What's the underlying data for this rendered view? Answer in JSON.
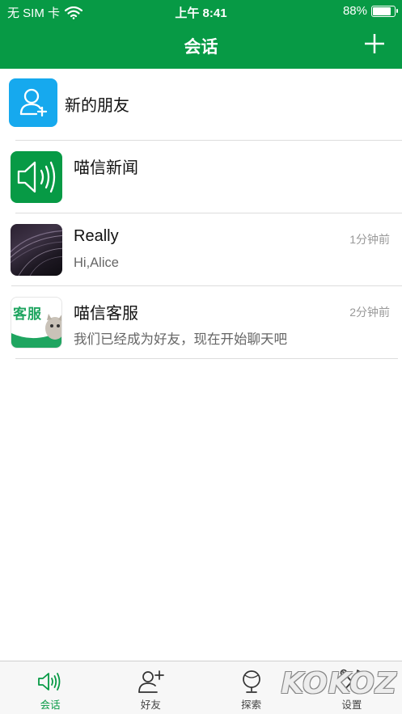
{
  "status_bar": {
    "carrier": "无 SIM 卡",
    "time": "上午 8:41",
    "battery": "88%"
  },
  "header": {
    "title": "会话",
    "add_icon": "plus-icon"
  },
  "conversations": [
    {
      "name": "新的朋友",
      "preview": "",
      "time": "",
      "avatar_icon": "add-friend-icon"
    },
    {
      "name": "喵信新闻",
      "preview": "",
      "time": "",
      "avatar_icon": "speaker-icon"
    },
    {
      "name": "Really",
      "preview": "Hi,Alice",
      "time": "1分钟前",
      "avatar_icon": "photo-avatar"
    },
    {
      "name": "喵信客服",
      "preview": "我们已经成为好友，现在开始聊天吧",
      "time": "2分钟前",
      "avatar_icon": "service-avatar",
      "avatar_text": "客服"
    }
  ],
  "tabbar": {
    "tabs": [
      {
        "label": "会话",
        "icon": "speaker-icon",
        "active": true
      },
      {
        "label": "好友",
        "icon": "add-friend-icon",
        "active": false
      },
      {
        "label": "探索",
        "icon": "globe-icon",
        "active": false
      },
      {
        "label": "设置",
        "icon": "tools-icon",
        "active": false
      }
    ]
  },
  "watermark": "KOKOZ",
  "colors": {
    "brand_green": "#079a45",
    "friend_blue": "#16a9ee",
    "divider": "#dddddd",
    "tab_bg": "#f7f7f7"
  }
}
